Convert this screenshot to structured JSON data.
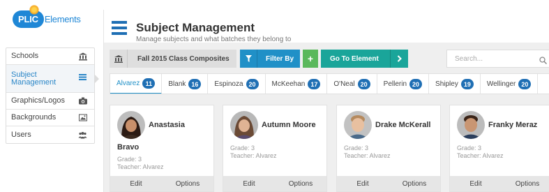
{
  "brand": {
    "logo_pill": "PLIC",
    "logo_text": "Elements"
  },
  "sidebar": {
    "items": [
      {
        "label": "Schools",
        "icon": "bank-icon"
      },
      {
        "label": "Subject Management",
        "icon": "list-icon",
        "active": true
      },
      {
        "label": "Graphics/Logos",
        "icon": "camera-icon"
      },
      {
        "label": "Backgrounds",
        "icon": "image-icon"
      },
      {
        "label": "Users",
        "icon": "users-icon"
      }
    ]
  },
  "header": {
    "title": "Subject Management",
    "subtitle": "Manage subjects and what batches they belong to"
  },
  "toolbar": {
    "batch_label": "Fall 2015 Class Composites",
    "filter_label": "Filter By",
    "add_label": "+",
    "goto_label": "Go To Element",
    "goto_arrow": "›"
  },
  "search": {
    "placeholder": "Search..."
  },
  "tabs": [
    {
      "label": "Alvarez",
      "count": "11",
      "active": true
    },
    {
      "label": "Blank",
      "count": "16"
    },
    {
      "label": "Espinoza",
      "count": "20"
    },
    {
      "label": "McKeehan",
      "count": "17"
    },
    {
      "label": "O'Neal",
      "count": "20"
    },
    {
      "label": "Pellerin",
      "count": "20"
    },
    {
      "label": "Shipley",
      "count": "19"
    },
    {
      "label": "Wellinger",
      "count": "20"
    }
  ],
  "cards": [
    {
      "name_line1": "Anastasia",
      "name_line2": "Bravo",
      "grade": "Grade: 3",
      "teacher": "Teacher: Alvarez",
      "edit": "Edit",
      "options": "Options"
    },
    {
      "name_line1": "Autumn Moore",
      "name_line2": "",
      "grade": "Grade: 3",
      "teacher": "Teacher: Alvarez",
      "edit": "Edit",
      "options": "Options"
    },
    {
      "name_line1": "Drake McKerall",
      "name_line2": "",
      "grade": "Grade: 3",
      "teacher": "Teacher: Alvarez",
      "edit": "Edit",
      "options": "Options"
    },
    {
      "name_line1": "Franky Meraz",
      "name_line2": "",
      "grade": "Grade: 3",
      "teacher": "Teacher: Alvarez",
      "edit": "Edit",
      "options": "Options"
    }
  ],
  "colors": {
    "primary_blue": "#2090c7",
    "add_green": "#5ab85c",
    "goto_teal": "#1aa59a",
    "badge_blue": "#1f6fb4",
    "batch_gray": "#dedede"
  }
}
